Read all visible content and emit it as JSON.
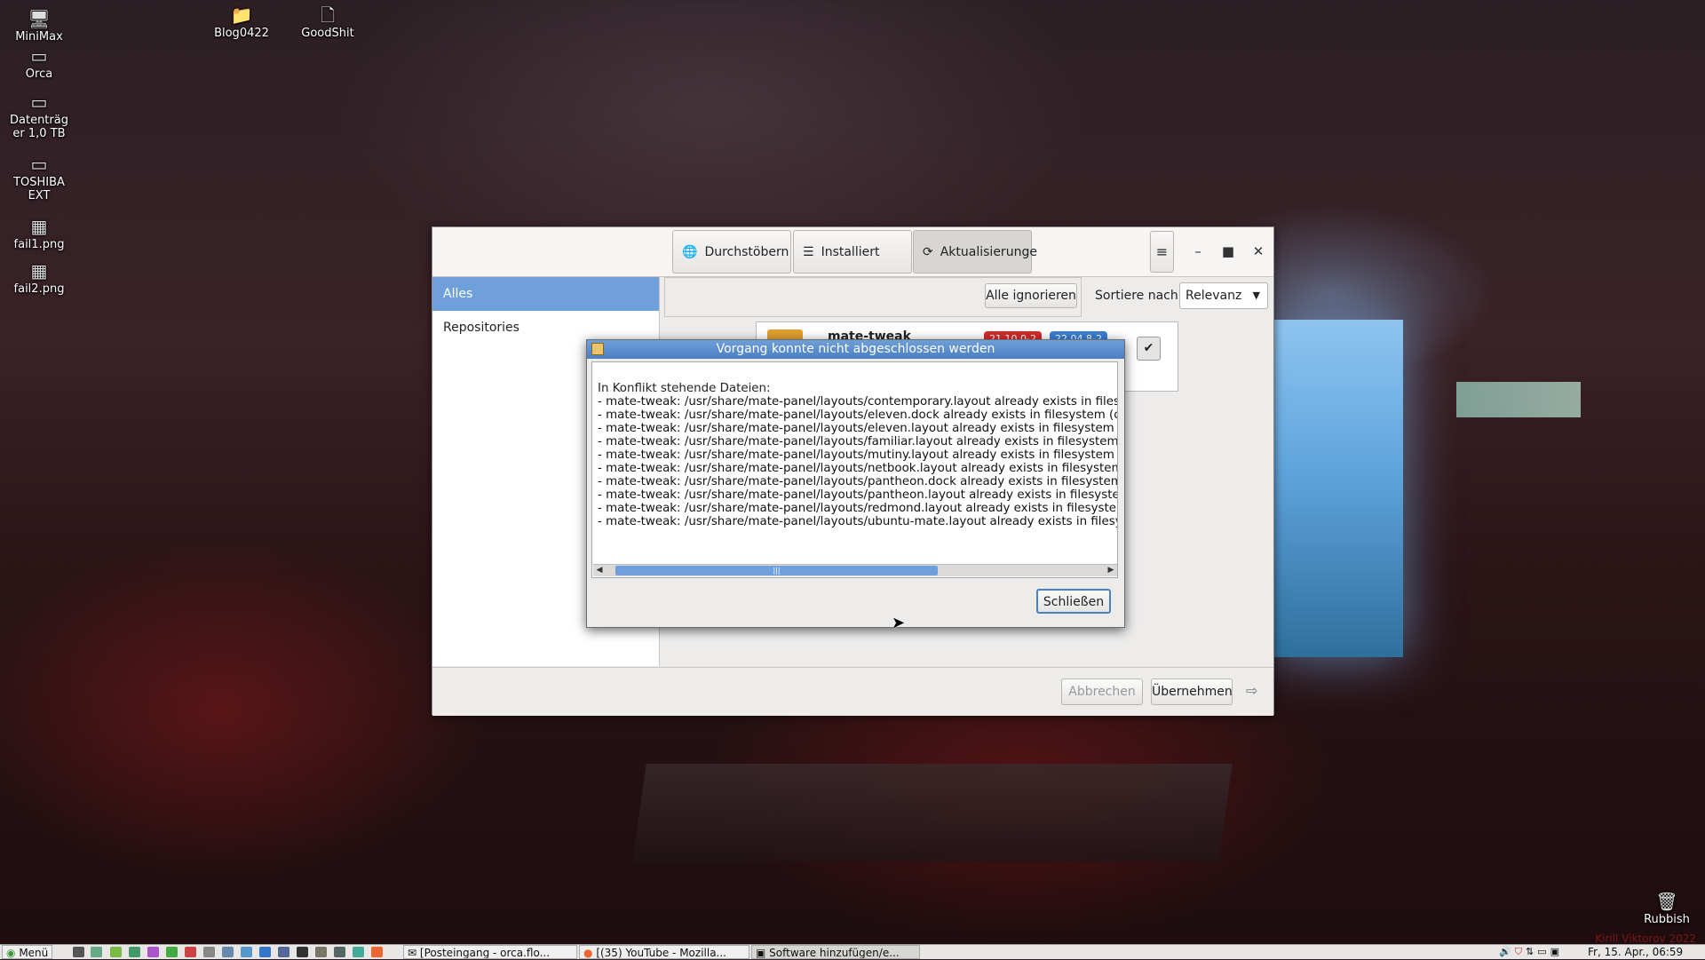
{
  "desktop": {
    "icons": [
      {
        "label": "MiniMax",
        "icon": "computer-icon"
      },
      {
        "label": "Orca",
        "icon": "drive-icon"
      },
      {
        "label": "Datenträg er 1,0 TB",
        "icon": "drive-icon"
      },
      {
        "label": "TOSHIBA EXT",
        "icon": "drive-icon"
      },
      {
        "label": "fail1.png",
        "icon": "image-file-icon"
      },
      {
        "label": "fail2.png",
        "icon": "image-file-icon"
      },
      {
        "label": "Blog0422",
        "icon": "folder-icon"
      },
      {
        "label": "GoodShit",
        "icon": "file-icon"
      },
      {
        "label": "Rubbish",
        "icon": "trash-icon"
      }
    ],
    "watermark": "Kirill Viktorov 2022"
  },
  "window": {
    "tabs": [
      {
        "label": "Durchstöbern",
        "icon": "globe-icon"
      },
      {
        "label": "Installiert",
        "icon": "list-icon"
      },
      {
        "label": "Aktualisierunge",
        "icon": "refresh-icon"
      }
    ],
    "sidebar": [
      {
        "label": "Alles",
        "selected": true
      },
      {
        "label": "Repositories",
        "selected": false
      }
    ],
    "ignore_all": "Alle ignorieren",
    "sort_label": "Sortiere nach",
    "sort_value": "Relevanz",
    "package": {
      "name": "mate-tweak",
      "old_version": "21.10.0-2",
      "new_version": "22.04.8-2"
    },
    "cancel_button": "Abbrechen",
    "apply_button": "Übernehmen",
    "colors": {
      "selection": "#6fa0dc",
      "badge_old": "#d42a2a",
      "badge_new": "#3a7fd6"
    }
  },
  "dialog": {
    "title": "Vorgang konnte nicht abgeschlossen werden",
    "heading": "In Konflikt stehende Dateien:",
    "lines": [
      "- mate-tweak: /usr/share/mate-panel/layouts/contemporary.layout already exists in filesyst",
      "- mate-tweak: /usr/share/mate-panel/layouts/eleven.dock already exists in filesystem (own",
      "- mate-tweak: /usr/share/mate-panel/layouts/eleven.layout already exists in filesystem (ow",
      "- mate-tweak: /usr/share/mate-panel/layouts/familiar.layout already exists in filesystem (o",
      "- mate-tweak: /usr/share/mate-panel/layouts/mutiny.layout already exists in filesystem (ow",
      "- mate-tweak: /usr/share/mate-panel/layouts/netbook.layout already exists in filesystem (o",
      "- mate-tweak: /usr/share/mate-panel/layouts/pantheon.dock already exists in filesystem (o",
      "- mate-tweak: /usr/share/mate-panel/layouts/pantheon.layout already exists in filesystem (",
      "- mate-tweak: /usr/share/mate-panel/layouts/redmond.layout already exists in filesystem (c",
      "- mate-tweak: /usr/share/mate-panel/layouts/ubuntu-mate.layout already exists in filesyste"
    ],
    "close_button": "Schließen"
  },
  "taskbar": {
    "menu": "Menü",
    "tasks": [
      "[Posteingang - orca.flo...",
      "[(35) YouTube - Mozilla...",
      "Software hinzufügen/e..."
    ],
    "clock": "Fr, 15. Apr., 06:59"
  }
}
